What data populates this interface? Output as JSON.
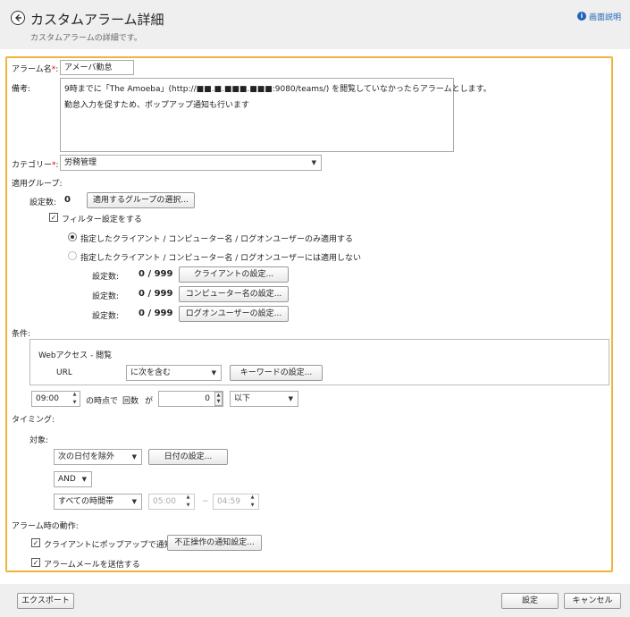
{
  "header": {
    "title": "カスタムアラーム詳細",
    "subtitle": "カスタムアラームの詳細です。",
    "help_label": "画面説明"
  },
  "form": {
    "alarm_name": {
      "label": "アラーム名",
      "required_mark": "*",
      "colon": ":",
      "value": "アメーバ勤怠"
    },
    "note": {
      "label": "備考:",
      "value": "9時までに「The Amoeba」(http://■■.■.■■■.■■■:9080/teams/) を閲覧していなかったらアラームとします。\n勤怠入力を促すため、ポップアップ通知も行います"
    },
    "category": {
      "label": "カテゴリー",
      "required_mark": "*",
      "colon": ":",
      "value": "労務管理"
    },
    "apply_group": {
      "label": "適用グループ:",
      "count_label": "設定数:",
      "count_value": "0",
      "select_button": "適用するグループの選択...",
      "filter_checkbox": "フィルター設定をする",
      "radio_apply": "指定したクライアント / コンピューター名 / ログオンユーザーのみ適用する",
      "radio_exclude": "指定したクライアント / コンピューター名 / ログオンユーザーには適用しない",
      "filters": [
        {
          "count_label": "設定数:",
          "count": "0 / 999",
          "button": "クライアントの設定..."
        },
        {
          "count_label": "設定数:",
          "count": "0 / 999",
          "button": "コンピューター名の設定..."
        },
        {
          "count_label": "設定数:",
          "count": "0 / 999",
          "button": "ログオンユーザーの設定..."
        }
      ]
    },
    "condition": {
      "label": "条件:",
      "item_title": "Webアクセス - 閲覧",
      "url_label": "URL",
      "match_select": "に次を含む",
      "keyword_button": "キーワードの設定...",
      "time_value": "09:00",
      "at_text": "の時点で",
      "count_text": "回数",
      "ga_text": "が",
      "count_value": "0",
      "compare_select": "以下"
    },
    "timing": {
      "label": "タイミング:",
      "target_label": "対象:",
      "date_select": "次の日付を除外",
      "date_button": "日付の設定...",
      "logic_select": "AND",
      "time_select": "すべての時間帯",
      "time_from": "05:00",
      "tilde": "~",
      "time_to": "04:59"
    },
    "action": {
      "label": "アラーム時の動作:",
      "popup_checkbox": "クライアントにポップアップで通知する",
      "popup_button": "不正操作の通知設定...",
      "mail_checkbox": "アラームメールを送信する"
    }
  },
  "footer": {
    "export_button": "エクスポート",
    "ok_button": "設定",
    "cancel_button": "キャンセル"
  },
  "icons": {
    "back": "back-arrow-icon",
    "help": "info-icon",
    "caret": "chevron-down-icon",
    "check": "checkmark-icon"
  },
  "colors": {
    "accent_frame": "#f0b43e",
    "help_link": "#1e63b8",
    "required": "#dd0000"
  }
}
